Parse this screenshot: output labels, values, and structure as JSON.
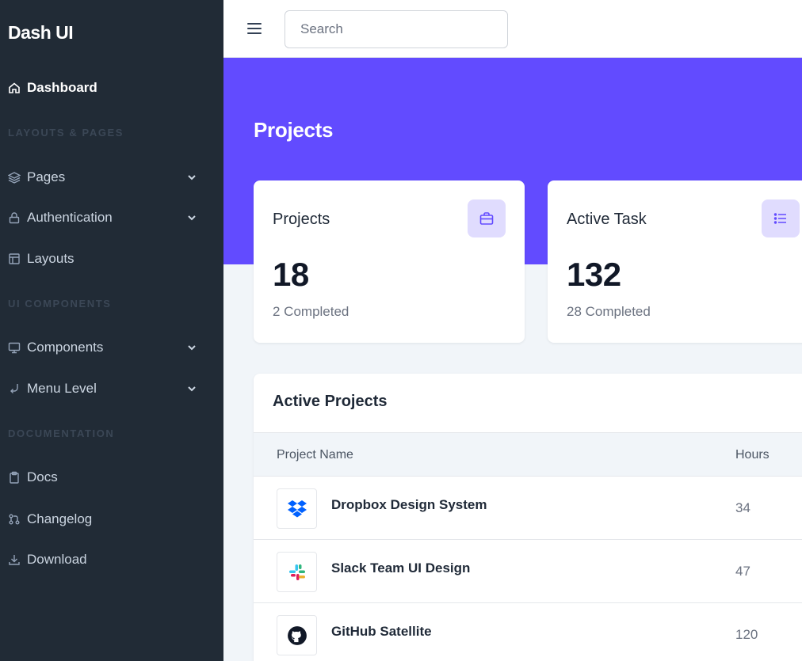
{
  "brand": "Dash UI",
  "search": {
    "placeholder": "Search"
  },
  "sidebar": {
    "dashboard": {
      "label": "Dashboard",
      "icon": "home-icon"
    },
    "sections": [
      "LAYOUTS & PAGES",
      "UI COMPONENTS",
      "DOCUMENTATION"
    ],
    "items": [
      {
        "label": "Pages",
        "icon": "layers-icon",
        "has_submenu": true
      },
      {
        "label": "Authentication",
        "icon": "lock-icon",
        "has_submenu": true
      },
      {
        "label": "Layouts",
        "icon": "layout-icon",
        "has_submenu": false
      },
      {
        "label": "Components",
        "icon": "monitor-icon",
        "has_submenu": true
      },
      {
        "label": "Menu Level",
        "icon": "corner-arrow-icon",
        "has_submenu": true
      },
      {
        "label": "Docs",
        "icon": "clipboard-icon",
        "has_submenu": false
      },
      {
        "label": "Changelog",
        "icon": "git-pull-request-icon",
        "has_submenu": false
      },
      {
        "label": "Download",
        "icon": "download-icon",
        "has_submenu": false
      }
    ]
  },
  "page": {
    "title": "Projects"
  },
  "stats": [
    {
      "title": "Projects",
      "value": "18",
      "sub": "2 Completed",
      "icon": "briefcase-icon"
    },
    {
      "title": "Active Task",
      "value": "132",
      "sub": "28 Completed",
      "icon": "list-icon"
    }
  ],
  "active_projects": {
    "title": "Active Projects",
    "columns": [
      "Project Name",
      "Hours"
    ],
    "rows": [
      {
        "name": "Dropbox Design System",
        "hours": "34",
        "logo": "dropbox-logo"
      },
      {
        "name": "Slack Team UI Design",
        "hours": "47",
        "logo": "slack-logo"
      },
      {
        "name": "GitHub Satellite",
        "hours": "120",
        "logo": "github-logo"
      }
    ]
  },
  "colors": {
    "sidebar_bg": "#212b36",
    "accent": "#624bff",
    "page_bg": "#f1f5f9",
    "icon_tile_bg": "#e0dcfe"
  }
}
